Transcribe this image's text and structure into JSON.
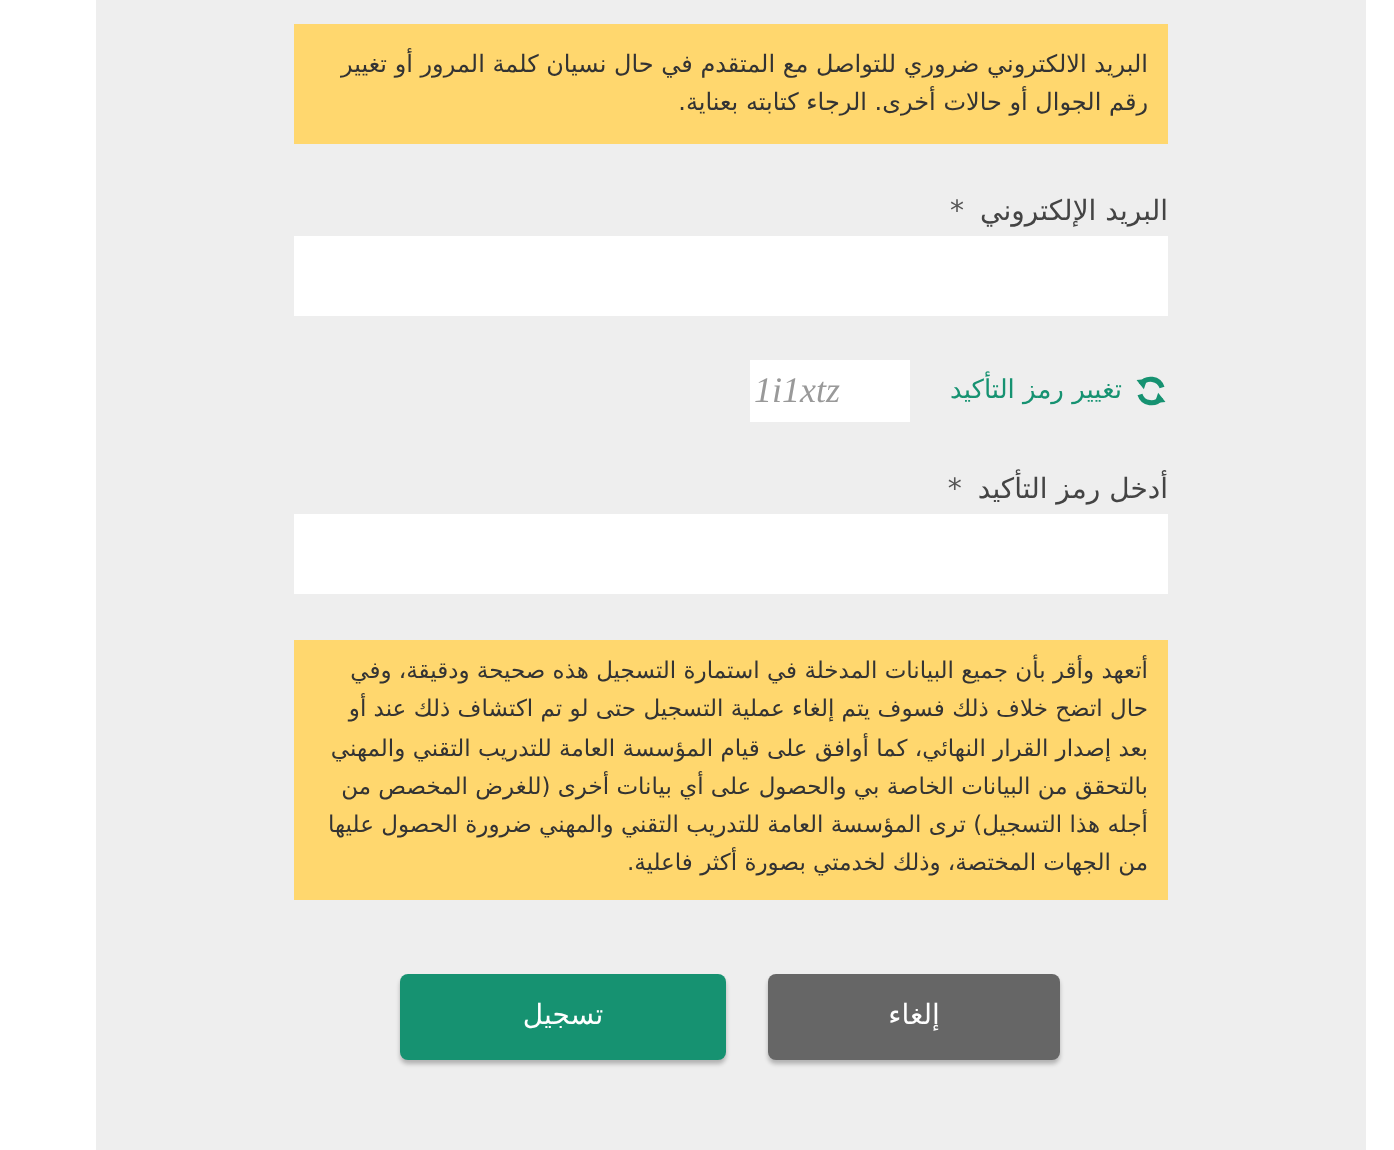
{
  "notice_top": {
    "text": "البريد الالكتروني ضروري للتواصل مع المتقدم في حال نسيان كلمة المرور أو تغيير رقم الجوال أو حالات أخرى. الرجاء كتابته بعناية."
  },
  "email_field": {
    "label": "البريد الإلكتروني",
    "required_mark": "*"
  },
  "captcha": {
    "code": "1i1xtz",
    "refresh_label": "تغيير رمز التأكيد"
  },
  "captcha_field": {
    "label": "أدخل رمز التأكيد",
    "required_mark": "*"
  },
  "notice_pledge": {
    "text": "أتعهد وأقر بأن جميع البيانات المدخلة في استمارة التسجيل هذه صحيحة ودقيقة، وفي حال اتضح خلاف ذلك فسوف يتم إلغاء عملية التسجيل حتى لو تم اكتشاف ذلك عند أو بعد إصدار القرار النهائي، كما أوافق على قيام المؤسسة العامة للتدريب التقني والمهني بالتحقق من البيانات الخاصة بي والحصول على أي بيانات أخرى (للغرض المخصص من أجله هذا التسجيل) ترى المؤسسة العامة للتدريب التقني والمهني ضرورة الحصول عليها من الجهات المختصة، وذلك لخدمتي بصورة أكثر فاعلية."
  },
  "buttons": [
    {
      "label": "إلغاء",
      "kind": "secondary"
    },
    {
      "label": "تسجيل",
      "kind": "primary"
    }
  ]
}
